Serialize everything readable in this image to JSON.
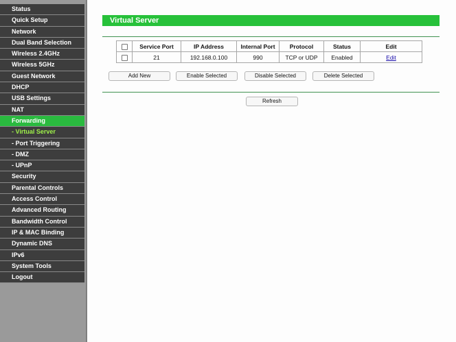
{
  "sidebar": {
    "items": [
      {
        "label": "Status"
      },
      {
        "label": "Quick Setup"
      },
      {
        "label": "Network"
      },
      {
        "label": "Dual Band Selection"
      },
      {
        "label": "Wireless 2.4GHz"
      },
      {
        "label": "Wireless 5GHz"
      },
      {
        "label": "Guest Network"
      },
      {
        "label": "DHCP"
      },
      {
        "label": "USB Settings"
      },
      {
        "label": "NAT"
      },
      {
        "label": "Forwarding"
      },
      {
        "label": "- Virtual Server"
      },
      {
        "label": "- Port Triggering"
      },
      {
        "label": "- DMZ"
      },
      {
        "label": "- UPnP"
      },
      {
        "label": "Security"
      },
      {
        "label": "Parental Controls"
      },
      {
        "label": "Access Control"
      },
      {
        "label": "Advanced Routing"
      },
      {
        "label": "Bandwidth Control"
      },
      {
        "label": "IP & MAC Binding"
      },
      {
        "label": "Dynamic DNS"
      },
      {
        "label": "IPv6"
      },
      {
        "label": "System Tools"
      },
      {
        "label": "Logout"
      }
    ],
    "active_color": "#2aba3f",
    "selected_sub_color": "#9ff24a"
  },
  "page": {
    "title": "Virtual Server",
    "accent": "#27c13a"
  },
  "table": {
    "headers": {
      "service_port": "Service Port",
      "ip_address": "IP Address",
      "internal_port": "Internal Port",
      "protocol": "Protocol",
      "status": "Status",
      "edit": "Edit"
    },
    "rows": [
      {
        "service_port": "21",
        "ip_address": "192.168.0.100",
        "internal_port": "990",
        "protocol": "TCP or UDP",
        "status": "Enabled",
        "edit": "Edit"
      }
    ]
  },
  "actions": {
    "add_new": "Add New",
    "enable_selected": "Enable Selected",
    "disable_selected": "Disable Selected",
    "delete_selected": "Delete Selected",
    "refresh": "Refresh"
  }
}
